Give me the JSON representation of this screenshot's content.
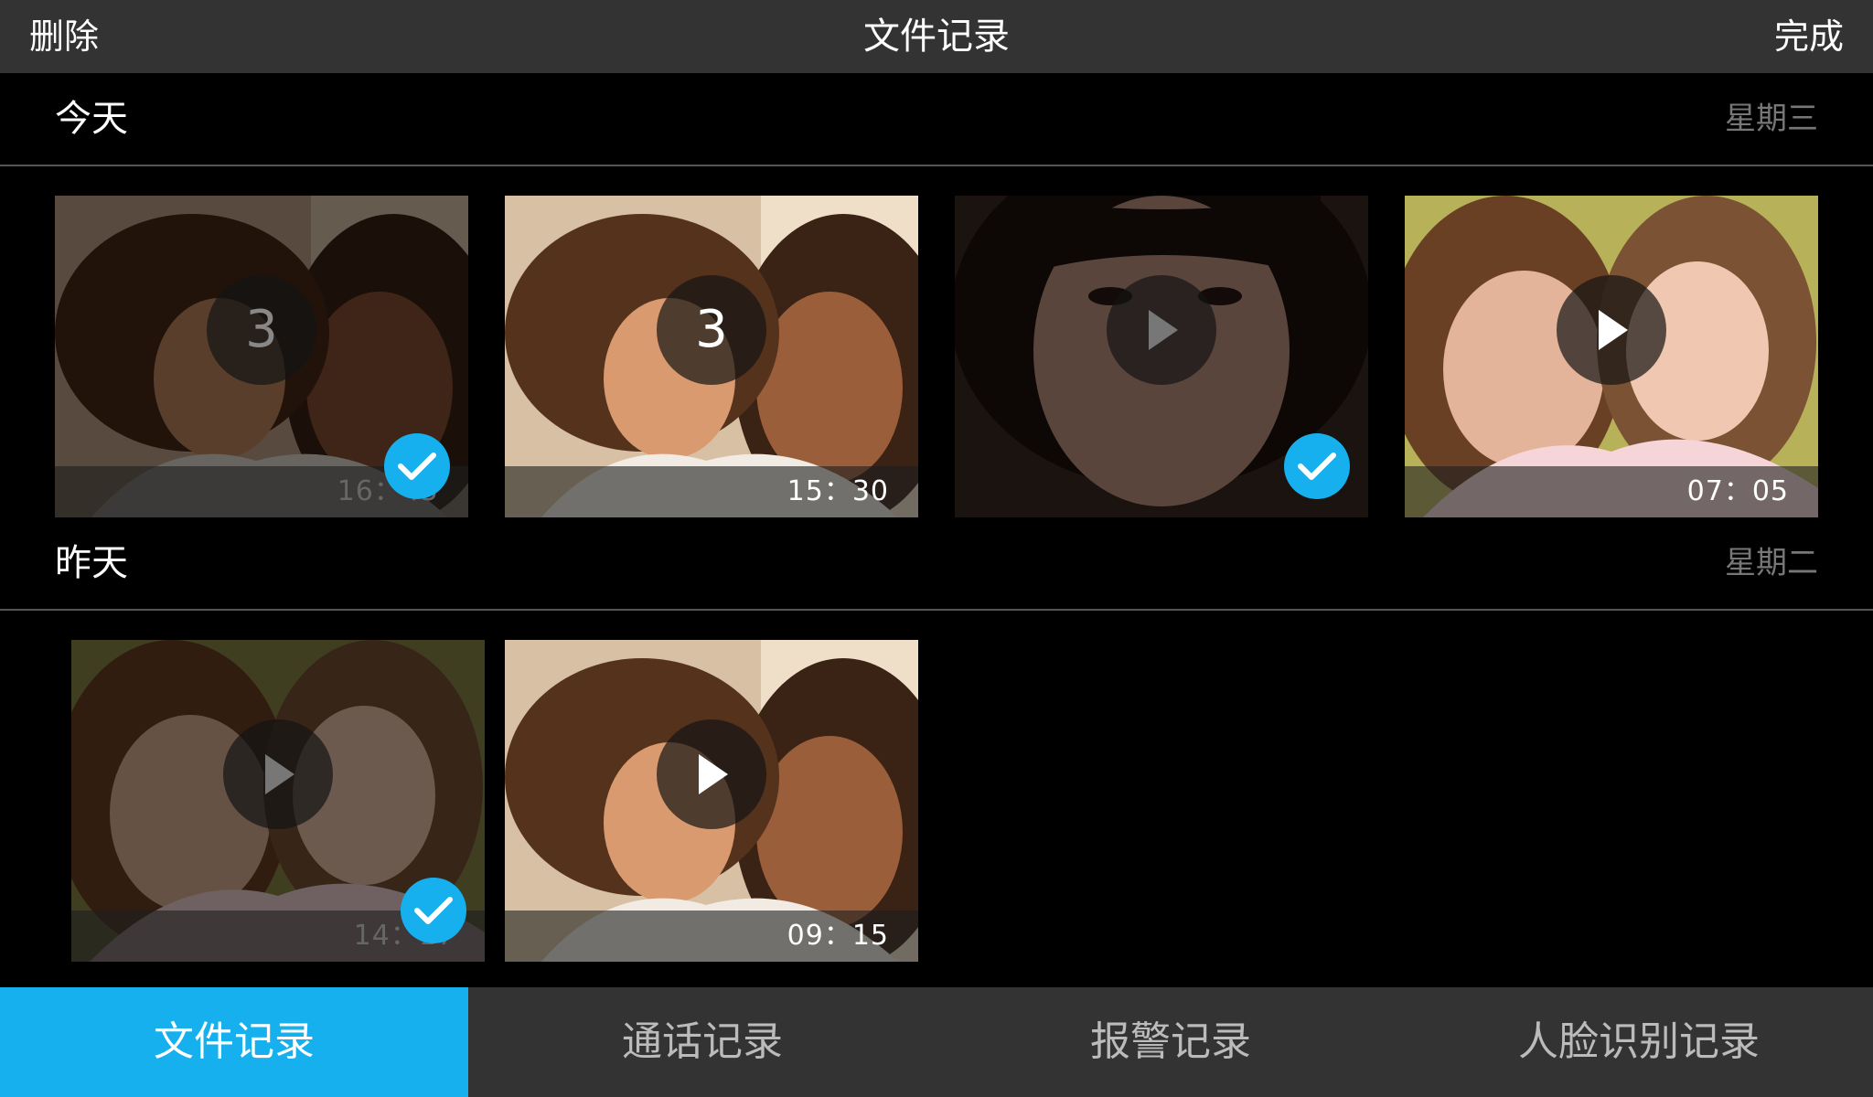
{
  "header": {
    "delete_label": "删除",
    "title": "文件记录",
    "done_label": "完成"
  },
  "sections": [
    {
      "label": "今天",
      "weekday": "星期三"
    },
    {
      "label": "昨天",
      "weekday": "星期二"
    }
  ],
  "thumbs": [
    {
      "time": "16：45",
      "count": "3",
      "selected": true
    },
    {
      "time": "15：30",
      "count": "3",
      "selected": false
    },
    {
      "time": "",
      "selected": true
    },
    {
      "time": "07：05",
      "selected": false
    },
    {
      "time": "14：17",
      "selected": true
    },
    {
      "time": "09：15",
      "selected": false
    }
  ],
  "tabs": [
    {
      "label": "文件记录",
      "active": true
    },
    {
      "label": "通话记录",
      "active": false
    },
    {
      "label": "报警记录",
      "active": false
    },
    {
      "label": "人脸识别记录",
      "active": false
    }
  ],
  "colors": {
    "accent": "#17b0ee",
    "topbar": "#333333",
    "tabbar": "#333333"
  }
}
